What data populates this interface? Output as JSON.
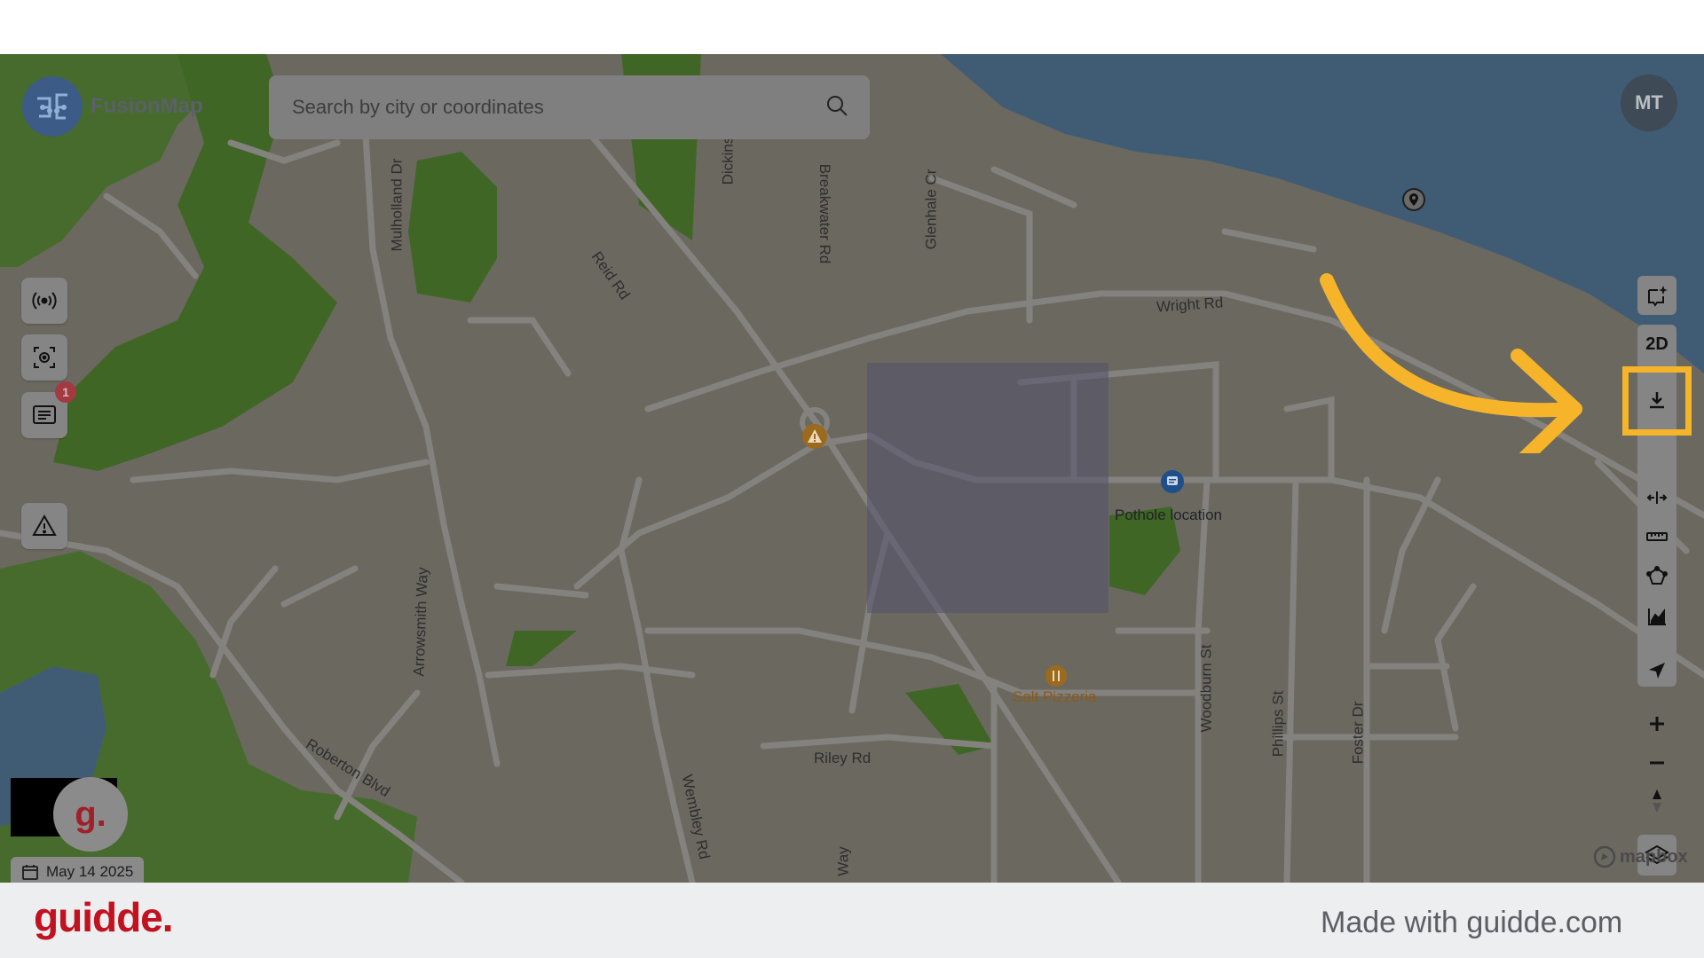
{
  "app": {
    "name": "FusionMap"
  },
  "search": {
    "placeholder": "Search by city or coordinates"
  },
  "user": {
    "initials": "MT"
  },
  "left_toolbar": {
    "buttons": [
      {
        "icon": "broadcast-icon"
      },
      {
        "icon": "scan-icon"
      },
      {
        "icon": "messages-icon",
        "badge": "1"
      },
      {
        "icon": "warning-icon"
      }
    ]
  },
  "right_toolbar": {
    "buttons": [
      "ai-sparkle-icon",
      "2D",
      "download-icon",
      "measure-width-icon",
      "ruler-icon",
      "polygon-icon",
      "chart-icon",
      "navigate-icon",
      "zoom-in-icon",
      "zoom-out-icon",
      "compass-icon",
      "layers-icon"
    ],
    "toggle_label": "2D",
    "highlighted": "download-icon",
    "highlight_color": "#f5b42a"
  },
  "map": {
    "street_labels": [
      "Mulholland Dr",
      "Dickins",
      "Breakwater Rd",
      "Glenhale Cr",
      "Reid Rd",
      "Wright Rd",
      "Arrowsmith Way",
      "Roberton Blvd",
      "Wembley Rd",
      "Riley Rd",
      "Woodburn St",
      "Phillips St",
      "Foster Dr",
      "Way"
    ],
    "pois": {
      "pothole": "Pothole location",
      "pizzeria": "Salt Pizzeria"
    },
    "attribution": "mapbox"
  },
  "date": "May 14 2025",
  "footer": {
    "brand": "guidde.",
    "tagline": "Made with guidde.com",
    "brand_color": "#c1121f"
  },
  "bubble_letter": "g."
}
